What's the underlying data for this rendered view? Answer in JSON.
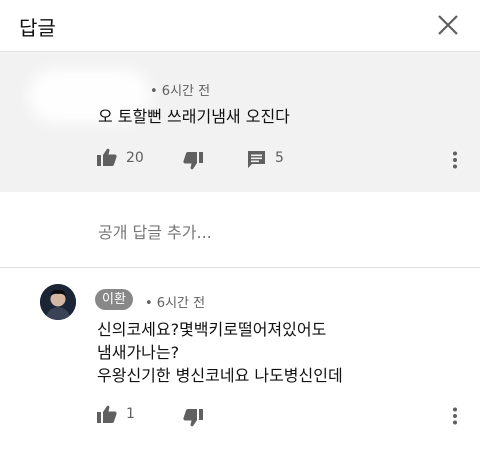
{
  "header": {
    "title": "답글"
  },
  "parent_comment": {
    "time": "• 6시간 전",
    "text": "오  토할뻔 쓰래기냄새 오진다",
    "likes": "20",
    "replies": "5"
  },
  "reply_box": {
    "placeholder": "공개 답글 추가..."
  },
  "reply": {
    "author": "이환",
    "time": "• 6시간 전",
    "lines": [
      "신의코세요?몇백키로떨어져있어도",
      "냄새가나는?",
      "우왕신기한 병신코네요 나도병신인데"
    ],
    "likes": "1"
  },
  "colors": {
    "background": "#ffffff",
    "highlight": "#f2f2f2",
    "icon": "#606060",
    "chip": "#888888"
  }
}
